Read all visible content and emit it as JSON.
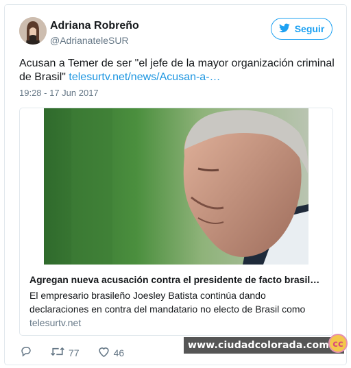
{
  "author": {
    "name": "Adriana Robreño",
    "handle": "@AdrianateleSUR"
  },
  "follow_button": {
    "label": "Seguir",
    "icon": "twitter-bird-icon"
  },
  "tweet": {
    "text": "Acusan a Temer de ser \"el jefe de la mayor organización criminal de Brasil\"",
    "link": "telesurtv.net/news/Acusan-a-…",
    "timestamp": "19:28 - 17 Jun 2017"
  },
  "link_card": {
    "image": "photo-man-head-bowed",
    "title": "Agregan nueva acusación contra el presidente de facto brasileño",
    "description": "El empresario brasileño Joesley Batista continúa dando declaraciones en contra del mandatario no electo de Brasil como",
    "domain": "telesurtv.net"
  },
  "actions": {
    "reply_icon": "reply-icon",
    "retweet_icon": "retweet-icon",
    "retweet_count": "77",
    "like_icon": "heart-icon",
    "like_count": "46"
  },
  "watermark": {
    "text": "www.ciudadcolorada.com"
  },
  "colors": {
    "accent": "#1da1f2",
    "link": "#1b95e0",
    "muted": "#657786",
    "border": "#e1e8ed"
  }
}
